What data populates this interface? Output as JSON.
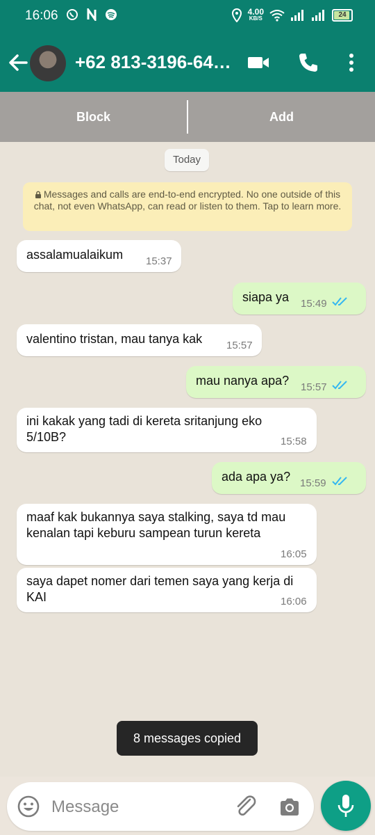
{
  "status_bar": {
    "time": "16:06",
    "app_icons": [
      "whatsapp-icon",
      "netflix-icon",
      "spotify-icon"
    ],
    "net_speed_value": "4.00",
    "net_speed_unit": "KB/S",
    "battery": "24"
  },
  "header": {
    "contact_name": "+62 813-3196-64…",
    "icons": [
      "back-arrow-icon",
      "video-call-icon",
      "phone-icon",
      "more-vert-icon"
    ]
  },
  "actions": {
    "block_label": "Block",
    "add_label": "Add"
  },
  "chat": {
    "date_label": "Today",
    "encryption_notice": "Messages and calls are end-to-end encrypted. No one outside of this chat, not even WhatsApp, can read or listen to them. Tap to learn more.",
    "messages": [
      {
        "direction": "in",
        "text": "assalamualaikum",
        "time": "15:37"
      },
      {
        "direction": "out",
        "text": "siapa ya",
        "time": "15:49",
        "status": "read"
      },
      {
        "direction": "in",
        "text": "valentino tristan, mau tanya kak",
        "time": "15:57"
      },
      {
        "direction": "out",
        "text": "mau nanya apa?",
        "time": "15:57",
        "status": "read"
      },
      {
        "direction": "in",
        "text_lines": [
          "ini kakak yang tadi di kereta sritanjung eko",
          "5/10B?"
        ],
        "time": "15:58"
      },
      {
        "direction": "out",
        "text": "ada apa ya?",
        "time": "15:59",
        "status": "read"
      },
      {
        "direction": "in",
        "text_lines": [
          "maaf kak bukannya saya stalking, saya td mau",
          "kenalan tapi keburu sampean turun kereta"
        ],
        "time": "16:05"
      },
      {
        "direction": "in",
        "text_lines": [
          "saya dapet nomer dari temen saya yang kerja di",
          "KAI"
        ],
        "time": "16:06"
      }
    ]
  },
  "toast": "8 messages copied",
  "composer": {
    "placeholder": "Message",
    "icons": [
      "emoji-icon",
      "attach-icon",
      "camera-icon",
      "mic-icon"
    ]
  },
  "colors": {
    "header": "#0b806f",
    "outgoing_bubble": "#dcf8c6",
    "incoming_bubble": "#ffffff",
    "read_ticks": "#34b7f1",
    "mic_button": "#0e9f86"
  }
}
